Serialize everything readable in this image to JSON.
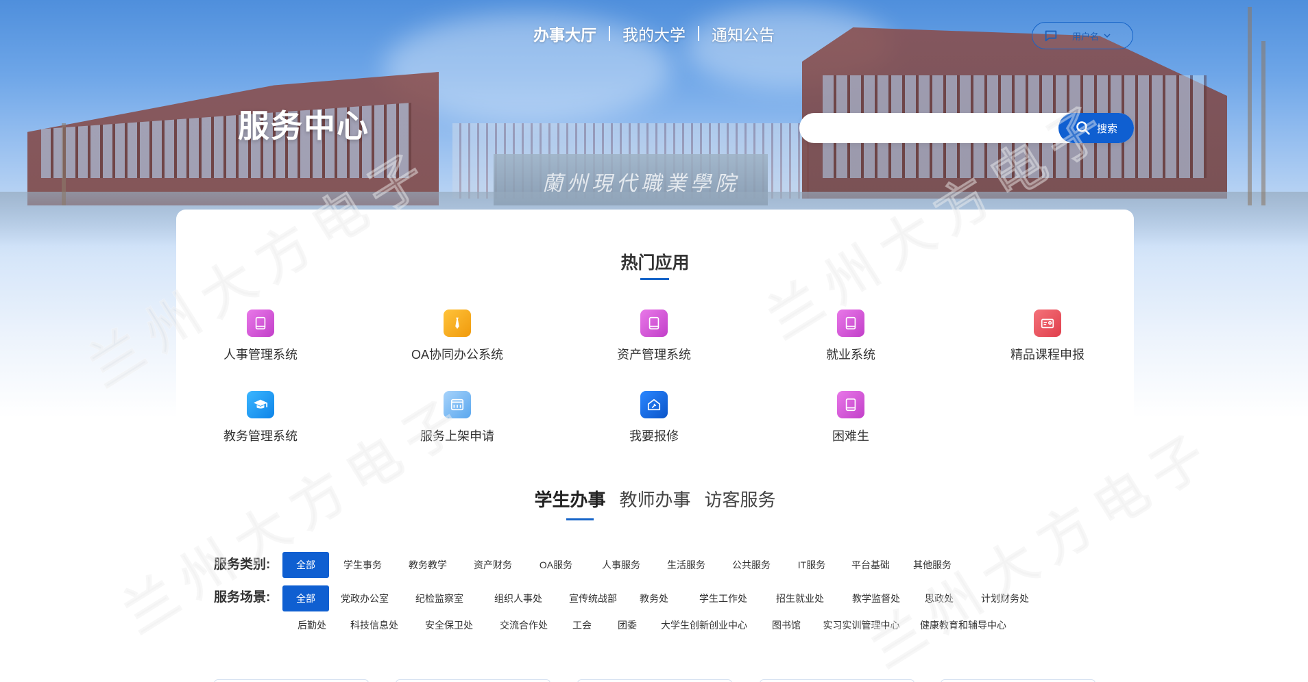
{
  "nav": {
    "items": [
      {
        "label": "办事大厅",
        "active": true
      },
      {
        "label": "我的大学",
        "active": false
      },
      {
        "label": "通知公告",
        "active": false
      }
    ]
  },
  "user": {
    "name": "用户名",
    "icon": "chat-icon"
  },
  "hero": {
    "title": "服务中心",
    "gate_text": "蘭州現代職業學院"
  },
  "search": {
    "placeholder": "",
    "button_label": "搜索"
  },
  "watermark": "兰州大方电子",
  "hot_apps": {
    "title": "热门应用",
    "items": [
      {
        "label": "人事管理系统",
        "icon": "book-icon",
        "color": "#d64ad6"
      },
      {
        "label": "OA协同办公系统",
        "icon": "tie-icon",
        "color": "#f5a31a"
      },
      {
        "label": "资产管理系统",
        "icon": "book-icon",
        "color": "#d64ad6"
      },
      {
        "label": "就业系统",
        "icon": "book-icon",
        "color": "#d64ad6"
      },
      {
        "label": "精品课程申报",
        "icon": "id-card-icon",
        "color": "#e8505b"
      },
      {
        "label": "教务管理系统",
        "icon": "graduation-cap-icon",
        "color": "#1a9bf0"
      },
      {
        "label": "服务上架申请",
        "icon": "bank-icon",
        "color": "#7bb8f2"
      },
      {
        "label": "我要报修",
        "icon": "home-repair-icon",
        "color": "#1668d8"
      },
      {
        "label": "困难生",
        "icon": "book-icon",
        "color": "#d64ad6"
      }
    ]
  },
  "tabs": [
    {
      "label": "学生办事",
      "active": true
    },
    {
      "label": "教师办事",
      "active": false
    },
    {
      "label": "访客服务",
      "active": false
    }
  ],
  "filters": {
    "category": {
      "label": "服务类别:",
      "options": [
        "全部",
        "学生事务",
        "教务教学",
        "资产财务",
        "OA服务",
        "人事服务",
        "生活服务",
        "公共服务",
        "IT服务",
        "平台基础",
        "其他服务"
      ]
    },
    "scene": {
      "label": "服务场景:",
      "options": [
        "全部",
        "党政办公室",
        "纪检监察室",
        "组织人事处",
        "宣传统战部",
        "教务处",
        "学生工作处",
        "招生就业处",
        "教学监督处",
        "思政处",
        "计划财务处",
        "后勤处",
        "科技信息处",
        "安全保卫处",
        "交流合作处",
        "工会",
        "团委",
        "大学生创新创业中心",
        "图书馆",
        "实习实训管理中心",
        "健康教育和辅导中心"
      ]
    }
  },
  "colors": {
    "accent": "#0f5fd1",
    "underline": "#1664c8"
  }
}
